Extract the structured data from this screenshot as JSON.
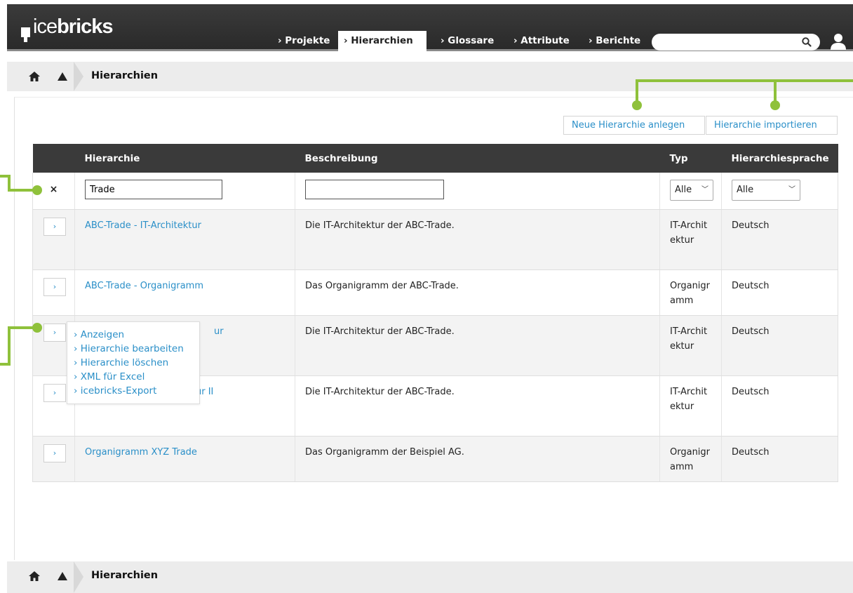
{
  "app": {
    "logo_light": "ice",
    "logo_bold": "bricks"
  },
  "nav": {
    "tabs": [
      {
        "label": "› Projekte"
      },
      {
        "label": "› Hierarchien"
      },
      {
        "label": "› Glossare"
      },
      {
        "label": "› Attribute"
      },
      {
        "label": "› Berichte"
      }
    ],
    "active_tab": "› Hierarchien"
  },
  "search": {
    "value": "",
    "placeholder": ""
  },
  "breadcrumb": {
    "title": "Hierarchien"
  },
  "actions": {
    "new_label": "Neue Hierarchie anlegen",
    "import_label": "Hierarchie importieren"
  },
  "table": {
    "headers": [
      "Hierarchie",
      "Beschreibung",
      "Typ",
      "Hierarchiesprache"
    ],
    "filter": {
      "clear": "×",
      "name_value": "Trade",
      "desc_value": "",
      "type_selected": "Alle",
      "lang_selected": "Alle"
    },
    "rows": [
      {
        "button": "›",
        "name": "ABC-Trade - IT-Architektur",
        "description": "Die IT-Architektur der ABC-Trade.",
        "type": "IT-Architektur",
        "language": "Deutsch"
      },
      {
        "button": "›",
        "name": "ABC-Trade - Organigramm",
        "description": "Das Organigramm der ABC-Trade.",
        "type": "Organigramm",
        "language": "Deutsch"
      },
      {
        "button": "›",
        "name": "ur",
        "description": "Die IT-Architektur der ABC-Trade.",
        "type": "IT-Architektur",
        "language": "Deutsch"
      },
      {
        "button": "›",
        "name": "ur II",
        "description": "Die IT-Architektur der ABC-Trade.",
        "type": "IT-Architektur",
        "language": "Deutsch"
      },
      {
        "button": "›",
        "name": "Organigramm XYZ Trade",
        "description": "Das Organigramm der Beispiel AG.",
        "type": "Organigramm",
        "language": "Deutsch"
      }
    ]
  },
  "context_menu": {
    "items": [
      "Anzeigen",
      "Hierarchie bearbeiten",
      "Hierarchie löschen",
      "XML für Excel",
      "icebricks-Export"
    ]
  },
  "colors": {
    "accent": "#8fc13b",
    "link": "#2a8fc8",
    "header": "#333333"
  }
}
